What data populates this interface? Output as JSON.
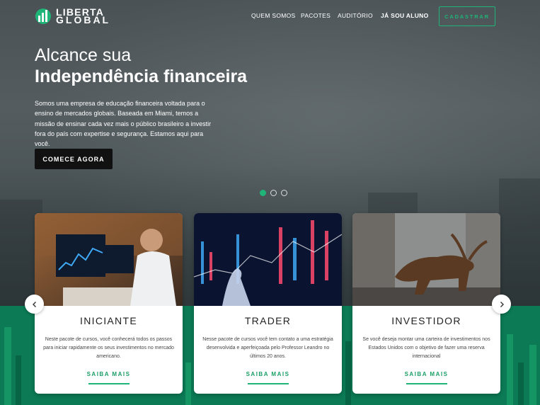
{
  "brand": {
    "line1": "LIBERTA",
    "line2": "GLOBAL",
    "accent": "#1fb478",
    "green_band": "#0b7a55"
  },
  "nav": {
    "items": [
      "QUEM SOMOS",
      "PACOTES",
      "AUDITÓRIO",
      "JÁ SOU ALUNO"
    ],
    "cta": "CADASTRAR"
  },
  "hero": {
    "title_line1": "Alcance sua",
    "title_line2": "Independência financeira",
    "description": "Somos uma empresa de educação financeira voltada para o ensino de mercados globais. Baseada em Miami, temos a missão de ensinar cada vez mais o público brasileiro a investir fora do país com expertise e segurança. Estamos aqui para você.",
    "button": "COMECE AGORA",
    "slides": 3,
    "active_slide": 1
  },
  "cards": [
    {
      "title": "INICIANTE",
      "text": "Neste pacote de cursos, você conhecerá todos os passos para iniciar rapidamente os seus investimentos no mercado americano.",
      "link": "SAIBA MAIS",
      "image": "man-at-trading-desk"
    },
    {
      "title": "TRADER",
      "text": "Nesse pacote de cursos você tem contato a uma estratégia desenvolvida e aperfeiçoada pelo Professor Leandro no últimos 20 anos.",
      "link": "SAIBA MAIS",
      "image": "finger-touching-stock-chart"
    },
    {
      "title": "INVESTIDOR",
      "text": "Se você deseja montar uma carteira de investimentos nos Estados Unidos com o objetivo de fazer uma reserva internacional",
      "link": "SAIBA MAIS",
      "image": "wall-street-bull"
    }
  ],
  "carousel": {
    "prev_icon": "chevron-left-icon",
    "next_icon": "chevron-right-icon"
  }
}
